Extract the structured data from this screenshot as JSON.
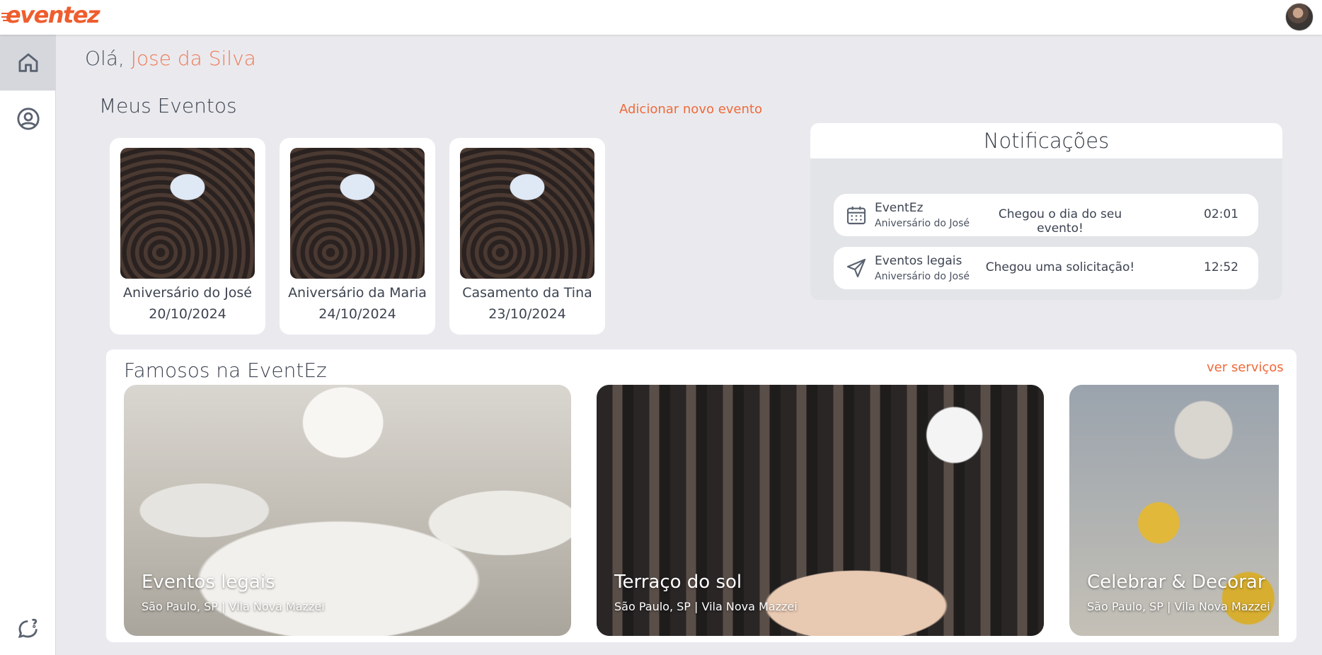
{
  "app": {
    "logo_text": "eventez",
    "brand_color": "#ef5d2e"
  },
  "sidebar": {
    "items": [
      {
        "icon": "home-icon",
        "active": true
      },
      {
        "icon": "user-icon",
        "active": false
      },
      {
        "icon": "chat-help-icon",
        "active": false
      }
    ]
  },
  "greeting": {
    "prefix": "Olá,",
    "name": "Jose da Silva"
  },
  "my_events": {
    "title": "Meus Eventos",
    "add_link": "Adicionar novo evento",
    "events": [
      {
        "name": "Aniversário do José",
        "date": "20/10/2024"
      },
      {
        "name": "Aniversário da Maria",
        "date": "24/10/2024"
      },
      {
        "name": "Casamento da Tina",
        "date": "23/10/2024"
      }
    ]
  },
  "notifications": {
    "title": "Notificações",
    "items": [
      {
        "icon": "calendar-icon",
        "sender": "EventEz",
        "event": "Aniversário do José",
        "message": "Chegou o dia do seu evento!",
        "time": "02:01"
      },
      {
        "icon": "send-icon",
        "sender": "Eventos legais",
        "event": "Aniversário do José",
        "message": "Chegou uma solicitação!",
        "time": "12:52"
      }
    ]
  },
  "famous": {
    "title": "Famosos na EventEz",
    "link": "ver serviços",
    "items": [
      {
        "name": "Eventos legais",
        "location": "São Paulo, SP | Vila Nova Mazzei"
      },
      {
        "name": "Terraço do sol",
        "location": "São Paulo, SP | Vila Nova Mazzei"
      },
      {
        "name": "Celebrar & Decorar",
        "location": "São Paulo, SP | Vila Nova Mazzei"
      }
    ]
  }
}
